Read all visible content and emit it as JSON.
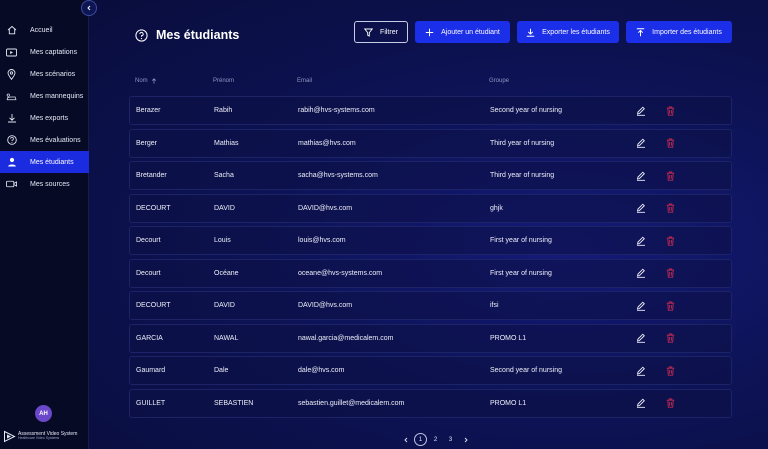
{
  "sidebar": {
    "items": [
      {
        "label": "Accueil",
        "icon": "home-icon"
      },
      {
        "label": "Mes captations",
        "icon": "video-play-icon"
      },
      {
        "label": "Mes scénarios",
        "icon": "map-pin-icon"
      },
      {
        "label": "Mes mannequins",
        "icon": "manikin-icon"
      },
      {
        "label": "Mes exports",
        "icon": "download-icon"
      },
      {
        "label": "Mes évaluations",
        "icon": "question-circle-icon"
      },
      {
        "label": "Mes étudiants",
        "icon": "user-icon",
        "active": true
      },
      {
        "label": "Mes sources",
        "icon": "camera-icon"
      }
    ],
    "avatar": "AH",
    "logo": {
      "title": "Assessment Video System",
      "subtitle": "Healthcare Video Systems"
    }
  },
  "header": {
    "title": "Mes étudiants",
    "filter_label": "Filtrer",
    "add_label": "Ajouter un étudiant",
    "export_label": "Exporter les étudiants",
    "import_label": "Importer des étudiants"
  },
  "table": {
    "columns": {
      "nom": "Nom",
      "prenom": "Prénom",
      "email": "Email",
      "groupe": "Groupe"
    },
    "rows": [
      {
        "nom": "Berazer",
        "prenom": "Rabih",
        "email": "rabih@hvs-systems.com",
        "groupe": "Second year of nursing"
      },
      {
        "nom": "Berger",
        "prenom": "Mathias",
        "email": "mathias@hvs.com",
        "groupe": "Third year of nursing"
      },
      {
        "nom": "Bretander",
        "prenom": "Sacha",
        "email": "sacha@hvs-systems.com",
        "groupe": "Third year of nursing"
      },
      {
        "nom": "DECOURT",
        "prenom": "DAVID",
        "email": "DAVID@hvs.com",
        "groupe": "ghjk"
      },
      {
        "nom": "Decourt",
        "prenom": "Louis",
        "email": "louis@hvs.com",
        "groupe": "First year of nursing"
      },
      {
        "nom": "Decourt",
        "prenom": "Océane",
        "email": "oceane@hvs-systems.com",
        "groupe": "First year of nursing"
      },
      {
        "nom": "DECOURT",
        "prenom": "DAVID",
        "email": "DAVID@hvs.com",
        "groupe": "ifsi"
      },
      {
        "nom": "GARCIA",
        "prenom": "NAWAL",
        "email": "nawal.garcia@medicalem.com",
        "groupe": "PROMO L1"
      },
      {
        "nom": "Gaumard",
        "prenom": "Dale",
        "email": "dale@hvs.com",
        "groupe": "Second year of nursing"
      },
      {
        "nom": "GUILLET",
        "prenom": "SEBASTIEN",
        "email": "sebastien.guillet@medicalem.com",
        "groupe": "PROMO L1"
      }
    ]
  },
  "pagination": {
    "pages": [
      "1",
      "2",
      "3"
    ],
    "current": "1"
  },
  "colors": {
    "accent": "#1b2ee8",
    "delete": "#c2284f",
    "bg": "#0b0f3a"
  }
}
